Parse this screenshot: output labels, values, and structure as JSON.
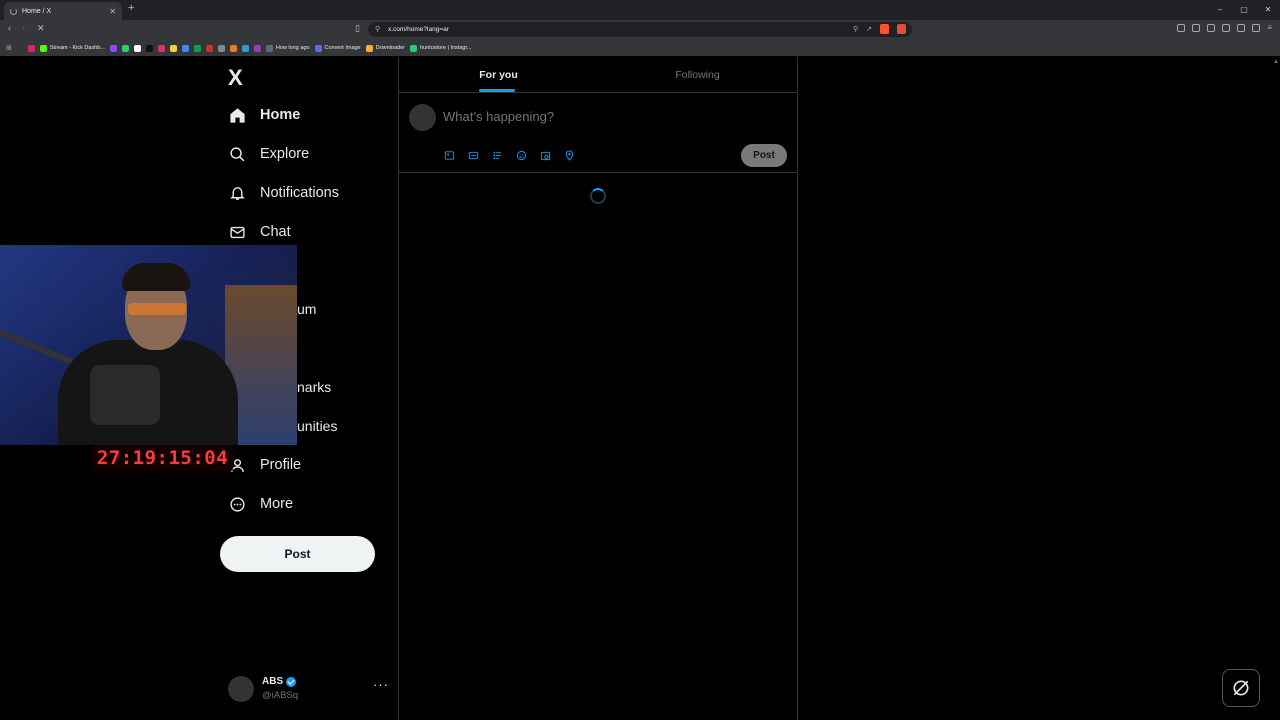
{
  "browser": {
    "tab_title": "Home / X",
    "new_tab": "+",
    "url": "x.com/home?lang=ar",
    "window_controls": [
      "–",
      "▢",
      "✕"
    ],
    "bookmarks": [
      {
        "label": "",
        "color": "#e0245e"
      },
      {
        "label": "Stream - Kick Dashb...",
        "color": "#53fc18"
      },
      {
        "label": "",
        "color": "#9146ff"
      },
      {
        "label": "",
        "color": "#25d366"
      },
      {
        "label": "",
        "color": "#ffffff"
      },
      {
        "label": "",
        "color": "#111111"
      },
      {
        "label": "",
        "color": "#e1306c"
      },
      {
        "label": "",
        "color": "#f4d03f"
      },
      {
        "label": "",
        "color": "#4285f4"
      },
      {
        "label": "",
        "color": "#0f9d58"
      },
      {
        "label": "",
        "color": "#c0392b"
      },
      {
        "label": "",
        "color": "#7f8c8d"
      },
      {
        "label": "",
        "color": "#e67e22"
      },
      {
        "label": "",
        "color": "#3498db"
      },
      {
        "label": "",
        "color": "#8e44ad"
      },
      {
        "label": "How long ago",
        "color": "#5d6d7e"
      },
      {
        "label": "Convert Image",
        "color": "#5b6ee1"
      },
      {
        "label": "Downloader",
        "color": "#f5b041"
      },
      {
        "label": "huntostore | Instagr...",
        "color": "#2ecc71"
      }
    ]
  },
  "sidebar": {
    "logo": "X",
    "items": [
      {
        "label": "Home",
        "icon": "home-icon"
      },
      {
        "label": "Explore",
        "icon": "search-icon"
      },
      {
        "label": "Notifications",
        "icon": "bell-icon"
      },
      {
        "label": "Chat",
        "icon": "mail-icon"
      },
      {
        "label": "Profile",
        "icon": "person-icon"
      },
      {
        "label": "More",
        "icon": "more-circle-icon"
      }
    ],
    "partial_items": [
      "um",
      "narks",
      "unities"
    ],
    "post_button": "Post",
    "account": {
      "name": "ABS",
      "handle": "@iABSq",
      "more": "···"
    }
  },
  "main": {
    "tabs": [
      {
        "label": "For you",
        "active": true
      },
      {
        "label": "Following",
        "active": false
      }
    ],
    "compose": {
      "placeholder": "What’s happening?",
      "post_button": "Post",
      "tools": [
        "image-icon",
        "gif-icon",
        "poll-icon",
        "emoji-icon",
        "schedule-icon",
        "location-icon"
      ]
    }
  },
  "overlay": {
    "timer": "27:19:15:04"
  },
  "colors": {
    "accent": "#1d9bf0",
    "background": "#000000",
    "border": "#2f3336",
    "muted": "#71767b"
  }
}
